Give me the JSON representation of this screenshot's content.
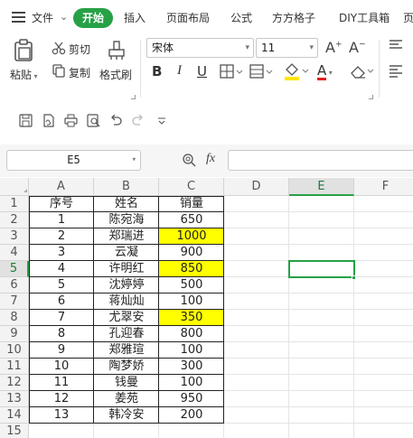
{
  "menu": {
    "file_label": "文件",
    "start_tab": "开始",
    "items": [
      "插入",
      "页面布局",
      "公式",
      "方方格子",
      "DIY工具箱",
      "页"
    ]
  },
  "ribbon": {
    "paste_label": "粘贴",
    "cut_label": "剪切",
    "copy_label": "复制",
    "format_painter_label": "格式刷",
    "font_name": "宋体",
    "font_size": "11",
    "bold": "B",
    "italic": "I",
    "underline": "U",
    "font_color_glyph": "A",
    "grow_font": "A",
    "shrink_font": "A",
    "highlight_color": "#ffe600",
    "font_color": "#e02020"
  },
  "formula_bar": {
    "name_box": "E5",
    "fx_label": "fx",
    "formula": ""
  },
  "sheet": {
    "columns": [
      "A",
      "B",
      "C",
      "D",
      "E",
      "F"
    ],
    "active_column": "E",
    "active_row": "5",
    "rows": [
      "1",
      "2",
      "3",
      "4",
      "5",
      "6",
      "7",
      "8",
      "9",
      "10",
      "11",
      "12",
      "13",
      "14",
      "15"
    ],
    "header_row": [
      "序号",
      "姓名",
      "销量"
    ],
    "data": [
      {
        "no": "1",
        "name": "陈宛海",
        "sales": "650",
        "highlight": false
      },
      {
        "no": "2",
        "name": "郑瑞进",
        "sales": "1000",
        "highlight": true
      },
      {
        "no": "3",
        "name": "云凝",
        "sales": "900",
        "highlight": false
      },
      {
        "no": "4",
        "name": "许明红",
        "sales": "850",
        "highlight": true
      },
      {
        "no": "5",
        "name": "沈婷婷",
        "sales": "500",
        "highlight": false
      },
      {
        "no": "6",
        "name": "蒋灿灿",
        "sales": "100",
        "highlight": false
      },
      {
        "no": "7",
        "name": "尤翠安",
        "sales": "350",
        "highlight": true
      },
      {
        "no": "8",
        "name": "孔迎春",
        "sales": "800",
        "highlight": false
      },
      {
        "no": "9",
        "name": "郑雅瑄",
        "sales": "100",
        "highlight": false
      },
      {
        "no": "10",
        "name": "陶梦娇",
        "sales": "300",
        "highlight": false
      },
      {
        "no": "11",
        "name": "钱曼",
        "sales": "100",
        "highlight": false
      },
      {
        "no": "12",
        "name": "姜苑",
        "sales": "950",
        "highlight": false
      },
      {
        "no": "13",
        "name": "韩冷安",
        "sales": "200",
        "highlight": false
      }
    ],
    "highlight_color": "#ffff00",
    "selection_color": "#27a146"
  }
}
